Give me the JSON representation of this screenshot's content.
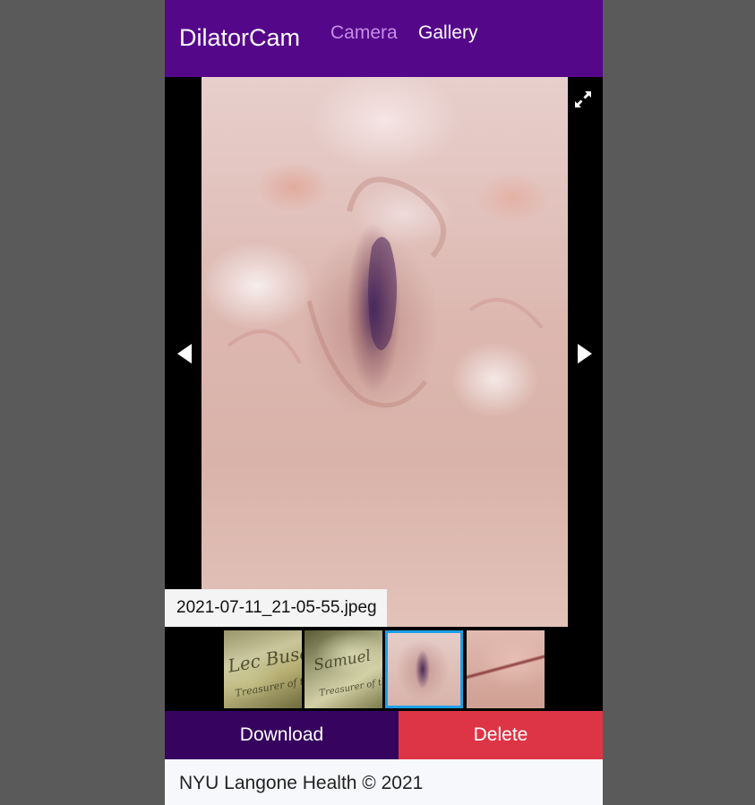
{
  "navbar": {
    "brand": "DilatorCam",
    "links": [
      {
        "label": "Camera",
        "active": false
      },
      {
        "label": "Gallery",
        "active": true
      }
    ],
    "background": "#55078a"
  },
  "viewer": {
    "filename": "2021-07-11_21-05-55.jpeg",
    "selected_thumbnail": 3,
    "thumbnails": [
      {
        "alt": "photo of banknote signature"
      },
      {
        "alt": "photo of banknote signature"
      },
      {
        "alt": "dilator camera photo"
      },
      {
        "alt": "dilator camera photo"
      }
    ],
    "thumbnail_text": [
      "Treasurer of the",
      "Treasurer of the"
    ],
    "icons": {
      "fullscreen": "expand-icon",
      "previous": "arrow-left-icon",
      "next": "arrow-right-icon"
    },
    "selected_border_color": "#1ea0e6"
  },
  "actions": {
    "download_label": "Download",
    "delete_label": "Delete",
    "download_color": "#36045f",
    "delete_color": "#dd3545"
  },
  "footer": {
    "text": "NYU Langone Health © 2021"
  }
}
